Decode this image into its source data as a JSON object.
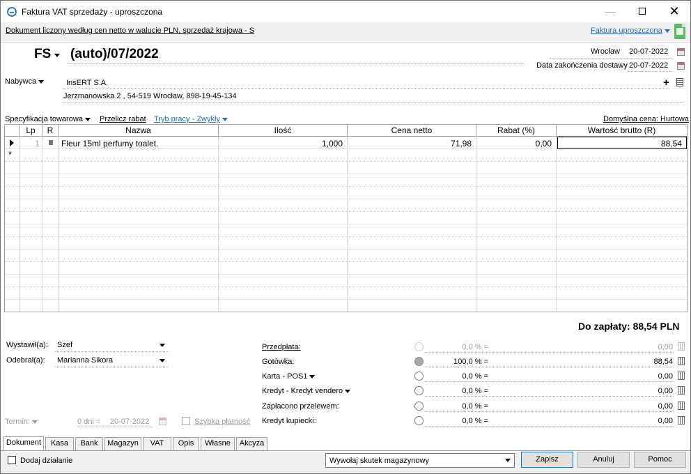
{
  "window": {
    "title": "Faktura VAT sprzedaży - uproszczona",
    "controls": {
      "minimize": "—",
      "maximize": "",
      "close": "✕"
    }
  },
  "infobar": {
    "description": "Dokument liczony według cen netto w walucie PLN, sprzedaż krajowa - S",
    "doc_type": "Faktura uproszczona",
    "export_icon": "excel-icon"
  },
  "header": {
    "series": "FS",
    "number": "(auto)/07/2022",
    "place": "Wrocław",
    "issue_date": "20-07-2022",
    "delivery_label": "Data zakończenia dostawy",
    "delivery_date": "20-07-2022"
  },
  "buyer": {
    "label": "Nabywca",
    "name": "InsERT S.A.",
    "address": "Jerzmanowska 2 , 54-519 Wrocław, 898-19-45-134"
  },
  "toolbar": {
    "spec": "Specyfikacja towarowa",
    "recalc": "Przelicz rabat",
    "mode": "Tryb pracy - Zwykły",
    "default_price": "Domyślna cena: Hurtowa"
  },
  "grid": {
    "columns": [
      "Lp",
      "R",
      "Nazwa",
      "Ilość",
      "Cena netto",
      "Rabat (%)",
      "Wartość brutto (R)"
    ],
    "rows": [
      {
        "lp": "1",
        "name": "Fleur 15ml perfumy toalet.",
        "qty": "1,000",
        "price": "71,98",
        "discount": "0,00",
        "gross": "88,54"
      }
    ],
    "new_row_marker": "*"
  },
  "total": "Do zapłaty: 88,54 PLN",
  "people": {
    "issued_label": "Wystawił(a):",
    "issued_value": "Szef",
    "received_label": "Odebrał(a):",
    "received_value": "Marianna Sikora"
  },
  "term": {
    "label": "Termin:",
    "days": "0 dni =",
    "date": "20-07-2022",
    "quick_payment": "Szybka płatność"
  },
  "payments": [
    {
      "label": "Przedpłata:",
      "pct": "0,0 % =",
      "amount": "0,00"
    },
    {
      "label": "Gotówka:",
      "pct": "100,0 % =",
      "amount": "88,54"
    },
    {
      "label": "Karta - POS1",
      "pct": "0,0 % =",
      "amount": "0,00"
    },
    {
      "label": "Kredyt - Kredyt vendero",
      "pct": "0,0 % =",
      "amount": "0,00"
    },
    {
      "label": "Zapłacono przelewem:",
      "pct": "0,0 % =",
      "amount": "0,00"
    },
    {
      "label": "Kredyt kupiecki:",
      "pct": "0,0 % =",
      "amount": "0,00"
    }
  ],
  "tabs": [
    "Dokument",
    "Kasa",
    "Bank",
    "Magazyn",
    "VAT",
    "Opis",
    "Własne",
    "Akcyza"
  ],
  "bottom": {
    "add_action": "Dodaj działanie",
    "warehouse_effect": "Wywołaj skutek magazynowy",
    "save": "Zapisz",
    "cancel": "Anuluj",
    "help": "Pomoc"
  },
  "colors": {
    "link": "#1a6fc2",
    "excel": "#5cb85c"
  }
}
